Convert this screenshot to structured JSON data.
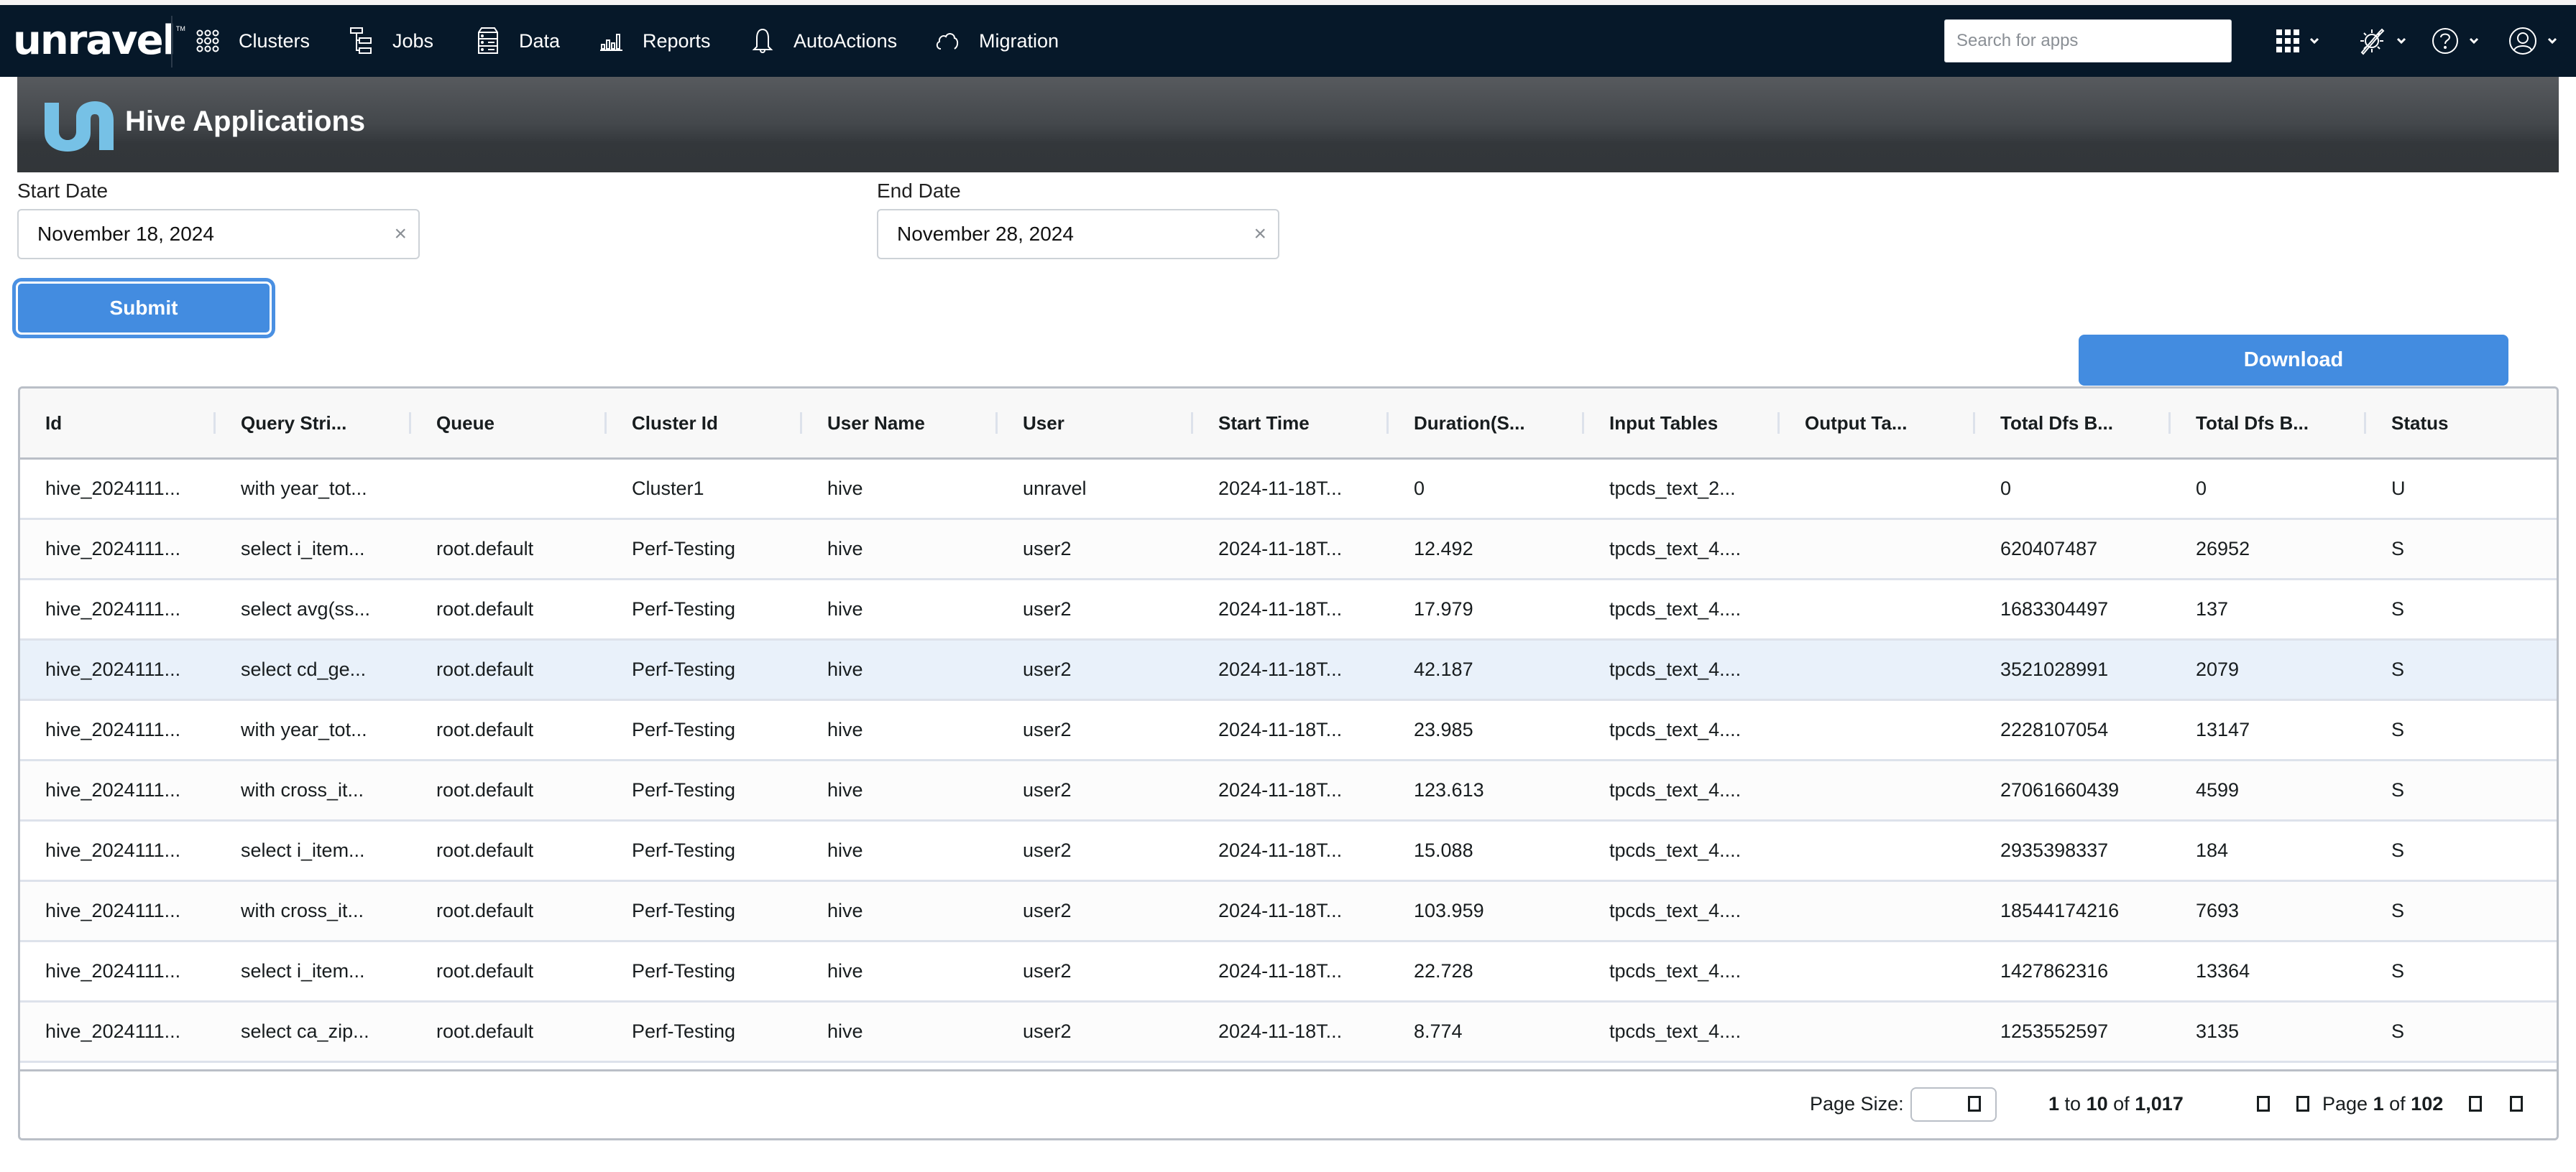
{
  "nav": {
    "brand": "unravel",
    "items": [
      {
        "label": "Clusters",
        "icon": "clusters-icon"
      },
      {
        "label": "Jobs",
        "icon": "jobs-icon"
      },
      {
        "label": "Data",
        "icon": "data-icon"
      },
      {
        "label": "Reports",
        "icon": "reports-icon"
      },
      {
        "label": "AutoActions",
        "icon": "bell-icon"
      },
      {
        "label": "Migration",
        "icon": "cloud-icon"
      }
    ],
    "search_placeholder": "Search for apps",
    "tools": [
      "apps-grid-icon",
      "settings-wrench-icon",
      "help-icon",
      "user-icon"
    ]
  },
  "banner": {
    "title": "Hive Applications"
  },
  "filters": {
    "start_label": "Start Date",
    "start_value": "November 18, 2024",
    "end_label": "End Date",
    "end_value": "November 28, 2024",
    "clear_glyph": "×",
    "submit_label": "Submit"
  },
  "download_label": "Download",
  "table": {
    "columns": [
      "Id",
      "Query Stri...",
      "Queue",
      "Cluster Id",
      "User Name",
      "User",
      "Start Time",
      "Duration(S...",
      "Input Tables",
      "Output Ta...",
      "Total Dfs B...",
      "Total Dfs B...",
      "Status"
    ],
    "rows": [
      [
        "hive_2024111...",
        "with year_tot...",
        "",
        "Cluster1",
        "hive",
        "unravel",
        "2024-11-18T...",
        "0",
        "tpcds_text_2...",
        "",
        "0",
        "0",
        "U"
      ],
      [
        "hive_2024111...",
        "select i_item...",
        "root.default",
        "Perf-Testing",
        "hive",
        "user2",
        "2024-11-18T...",
        "12.492",
        "tpcds_text_4....",
        "",
        "620407487",
        "26952",
        "S"
      ],
      [
        "hive_2024111...",
        "select avg(ss...",
        "root.default",
        "Perf-Testing",
        "hive",
        "user2",
        "2024-11-18T...",
        "17.979",
        "tpcds_text_4....",
        "",
        "1683304497",
        "137",
        "S"
      ],
      [
        "hive_2024111...",
        "select cd_ge...",
        "root.default",
        "Perf-Testing",
        "hive",
        "user2",
        "2024-11-18T...",
        "42.187",
        "tpcds_text_4....",
        "",
        "3521028991",
        "2079",
        "S"
      ],
      [
        "hive_2024111...",
        "with year_tot...",
        "root.default",
        "Perf-Testing",
        "hive",
        "user2",
        "2024-11-18T...",
        "23.985",
        "tpcds_text_4....",
        "",
        "2228107054",
        "13147",
        "S"
      ],
      [
        "hive_2024111...",
        "with cross_it...",
        "root.default",
        "Perf-Testing",
        "hive",
        "user2",
        "2024-11-18T...",
        "123.613",
        "tpcds_text_4....",
        "",
        "27061660439",
        "4599",
        "S"
      ],
      [
        "hive_2024111...",
        "select i_item...",
        "root.default",
        "Perf-Testing",
        "hive",
        "user2",
        "2024-11-18T...",
        "15.088",
        "tpcds_text_4....",
        "",
        "2935398337",
        "184",
        "S"
      ],
      [
        "hive_2024111...",
        "with cross_it...",
        "root.default",
        "Perf-Testing",
        "hive",
        "user2",
        "2024-11-18T...",
        "103.959",
        "tpcds_text_4....",
        "",
        "18544174216",
        "7693",
        "S"
      ],
      [
        "hive_2024111...",
        "select i_item...",
        "root.default",
        "Perf-Testing",
        "hive",
        "user2",
        "2024-11-18T...",
        "22.728",
        "tpcds_text_4....",
        "",
        "1427862316",
        "13364",
        "S"
      ],
      [
        "hive_2024111...",
        "select ca_zip...",
        "root.default",
        "Perf-Testing",
        "hive",
        "user2",
        "2024-11-18T...",
        "8.774",
        "tpcds_text_4....",
        "",
        "1253552597",
        "3135",
        "S"
      ]
    ],
    "hovered_row": 3
  },
  "pagination": {
    "page_size_label": "Page Size:",
    "from": "1",
    "to_word": "to",
    "to": "10",
    "of_word": "of",
    "total": "1,017",
    "page_word": "Page",
    "page": "1",
    "page_count": "102"
  },
  "colors": {
    "nav_bg": "#061829",
    "accent": "#438ce0",
    "hover_row": "#e9f1fa",
    "banner_logo": "#76c1e6"
  }
}
